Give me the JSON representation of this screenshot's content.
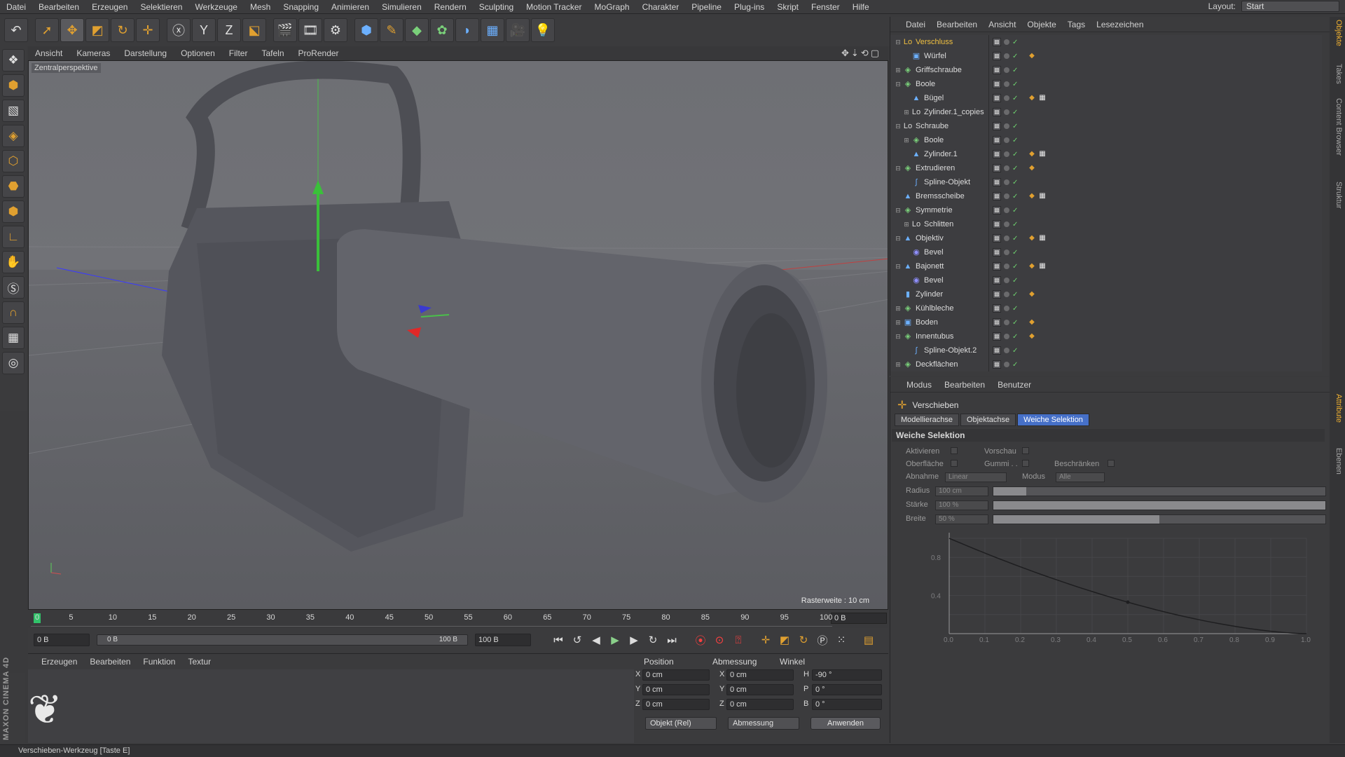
{
  "menubar": {
    "items": [
      "Datei",
      "Bearbeiten",
      "Erzeugen",
      "Selektieren",
      "Werkzeuge",
      "Mesh",
      "Snapping",
      "Animieren",
      "Simulieren",
      "Rendern",
      "Sculpting",
      "Motion Tracker",
      "MoGraph",
      "Charakter",
      "Pipeline",
      "Plug-ins",
      "Skript",
      "Fenster",
      "Hilfe"
    ],
    "layout_label": "Layout:",
    "layout_value": "Start"
  },
  "toolbar": {
    "icons": [
      "undo-icon",
      "live-selection-icon",
      "move-icon",
      "scale-icon",
      "rotate-icon",
      "add-tool-icon",
      "x-axis-icon",
      "y-axis-icon",
      "z-axis-icon",
      "coordinate-system-icon",
      "render-view-icon",
      "render-picture-viewer-icon",
      "edit-render-settings-icon",
      "cube-icon",
      "pen-icon",
      "subdivision-icon",
      "cloner-icon",
      "deformer-icon",
      "floor-icon",
      "camera-icon",
      "light-icon"
    ],
    "x_label": "X",
    "y_label": "Y",
    "z_label": "Z"
  },
  "viewport": {
    "menu": [
      "Ansicht",
      "Kameras",
      "Darstellung",
      "Optionen",
      "Filter",
      "Tafeln",
      "ProRender"
    ],
    "label": "Zentralperspektive",
    "raster": "Rasterweite : 10 cm"
  },
  "timeline": {
    "ticks": [
      "0",
      "5",
      "10",
      "15",
      "20",
      "25",
      "30",
      "35",
      "40",
      "45",
      "50",
      "55",
      "60",
      "65",
      "70",
      "75",
      "80",
      "85",
      "90",
      "95",
      "100"
    ],
    "end_field": "0 B",
    "current_start": "0 B",
    "range_start": "0 B",
    "range_end": "100 B",
    "max": "100 B"
  },
  "material": {
    "menu": [
      "Erzeugen",
      "Bearbeiten",
      "Funktion",
      "Textur"
    ]
  },
  "brand": {
    "maxon": "MAXON CINEMA 4D"
  },
  "coords": {
    "headers": [
      "Position",
      "Abmessung",
      "Winkel"
    ],
    "rows": [
      {
        "axis": "X",
        "pos": "0 cm",
        "daxis": "X",
        "dim": "0 cm",
        "aaxis": "H",
        "ang": "-90 °"
      },
      {
        "axis": "Y",
        "pos": "0 cm",
        "daxis": "Y",
        "dim": "0 cm",
        "aaxis": "P",
        "ang": "0 °"
      },
      {
        "axis": "Z",
        "pos": "0 cm",
        "daxis": "Z",
        "dim": "0 cm",
        "aaxis": "B",
        "ang": "0 °"
      }
    ],
    "mode": "Objekt (Rel)",
    "size_mode": "Abmessung",
    "apply": "Anwenden"
  },
  "objects": {
    "menu": [
      "Datei",
      "Bearbeiten",
      "Ansicht",
      "Objekte",
      "Tags",
      "Lesezeichen"
    ],
    "items": [
      {
        "name": "Verschluss",
        "indent": 0,
        "exp": "⊟",
        "icon": "Lo",
        "color": "#f0c040",
        "tags": []
      },
      {
        "name": "Würfel",
        "indent": 1,
        "exp": "",
        "icon": "▣",
        "color": "#6cb0ff",
        "tags": [
          "◆"
        ]
      },
      {
        "name": "Griffschraube",
        "indent": 0,
        "exp": "⊞",
        "icon": "◈",
        "color": "#7ad07a",
        "tags": []
      },
      {
        "name": "Boole",
        "indent": 0,
        "exp": "⊟",
        "icon": "◈",
        "color": "#7ad07a",
        "tags": []
      },
      {
        "name": "Bügel",
        "indent": 1,
        "exp": "",
        "icon": "▲",
        "color": "#6cb0ff",
        "tags": [
          "◆",
          "▦"
        ]
      },
      {
        "name": "Zylinder.1_copies",
        "indent": 1,
        "exp": "⊞",
        "icon": "Lo",
        "color": "#dcdcdc",
        "tags": []
      },
      {
        "name": "Schraube",
        "indent": 0,
        "exp": "⊟",
        "icon": "Lo",
        "color": "#dcdcdc",
        "tags": []
      },
      {
        "name": "Boole",
        "indent": 1,
        "exp": "⊞",
        "icon": "◈",
        "color": "#7ad07a",
        "tags": []
      },
      {
        "name": "Zylinder.1",
        "indent": 1,
        "exp": "",
        "icon": "▲",
        "color": "#6cb0ff",
        "tags": [
          "◆",
          "▦"
        ]
      },
      {
        "name": "Extrudieren",
        "indent": 0,
        "exp": "⊟",
        "icon": "◈",
        "color": "#7ad07a",
        "tags": [
          "◆"
        ]
      },
      {
        "name": "Spline-Objekt",
        "indent": 1,
        "exp": "",
        "icon": "∫",
        "color": "#6cb0ff",
        "tags": []
      },
      {
        "name": "Bremsscheibe",
        "indent": 0,
        "exp": "",
        "icon": "▲",
        "color": "#6cb0ff",
        "tags": [
          "◆",
          "▦"
        ]
      },
      {
        "name": "Symmetrie",
        "indent": 0,
        "exp": "⊟",
        "icon": "◈",
        "color": "#7ad07a",
        "tags": []
      },
      {
        "name": "Schlitten",
        "indent": 1,
        "exp": "⊞",
        "icon": "Lo",
        "color": "#dcdcdc",
        "tags": []
      },
      {
        "name": "Objektiv",
        "indent": 0,
        "exp": "⊟",
        "icon": "▲",
        "color": "#6cb0ff",
        "tags": [
          "◆",
          "▦"
        ]
      },
      {
        "name": "Bevel",
        "indent": 1,
        "exp": "",
        "icon": "◉",
        "color": "#8f8fff",
        "tags": []
      },
      {
        "name": "Bajonett",
        "indent": 0,
        "exp": "⊟",
        "icon": "▲",
        "color": "#6cb0ff",
        "tags": [
          "◆",
          "▦"
        ]
      },
      {
        "name": "Bevel",
        "indent": 1,
        "exp": "",
        "icon": "◉",
        "color": "#8f8fff",
        "tags": []
      },
      {
        "name": "Zylinder",
        "indent": 0,
        "exp": "",
        "icon": "▮",
        "color": "#6cb0ff",
        "tags": [
          "◆"
        ]
      },
      {
        "name": "Kühlbleche",
        "indent": 0,
        "exp": "⊞",
        "icon": "◈",
        "color": "#7ad07a",
        "tags": []
      },
      {
        "name": "Boden",
        "indent": 0,
        "exp": "⊞",
        "icon": "▣",
        "color": "#6cb0ff",
        "tags": [
          "◆"
        ]
      },
      {
        "name": "Innentubus",
        "indent": 0,
        "exp": "⊟",
        "icon": "◈",
        "color": "#7ad07a",
        "tags": [
          "◆"
        ]
      },
      {
        "name": "Spline-Objekt.2",
        "indent": 1,
        "exp": "",
        "icon": "∫",
        "color": "#6cb0ff",
        "tags": []
      },
      {
        "name": "Deckflächen",
        "indent": 0,
        "exp": "⊞",
        "icon": "◈",
        "color": "#7ad07a",
        "tags": []
      }
    ]
  },
  "side_tabs_top": [
    "Objekte",
    "Takes",
    "Content Browser",
    "Struktur"
  ],
  "side_tabs_bottom": [
    "Attribute",
    "Ebenen"
  ],
  "attributes": {
    "menu": [
      "Modus",
      "Bearbeiten",
      "Benutzer"
    ],
    "tool_name": "Verschieben",
    "tabs": [
      "Modellierachse",
      "Objektachse",
      "Weiche Selektion"
    ],
    "active_tab": "Weiche Selektion",
    "section": "Weiche Selektion",
    "aktivieren": "Aktivieren",
    "vorschau": "Vorschau",
    "oberflaeche": "Oberfläche",
    "gummi": "Gummi . .",
    "beschraenken": "Beschränken",
    "abnahme_label": "Abnahme",
    "abnahme_value": "Linear",
    "modus_label": "Modus",
    "modus_value": "Alle",
    "radius_label": "Radius",
    "radius_value": "100 cm",
    "radius_fraction": 0.1,
    "staerke_label": "Stärke",
    "staerke_value": "100 %",
    "staerke_fraction": 1.0,
    "breite_label": "Breite",
    "breite_value": "50 %",
    "breite_fraction": 0.5,
    "graph_y_ticks": [
      "0.8",
      "0.4"
    ],
    "graph_x_ticks": [
      "0.0",
      "0.1",
      "0.2",
      "0.3",
      "0.4",
      "0.5",
      "0.6",
      "0.7",
      "0.8",
      "0.9",
      "1.0"
    ]
  },
  "status": {
    "text": "Verschieben-Werkzeug [Taste E]"
  },
  "colors": {
    "accent": "#4670c8",
    "frame_marker": "#31c36a",
    "record": "#ff4040",
    "tool_orange": "#e0a030"
  }
}
